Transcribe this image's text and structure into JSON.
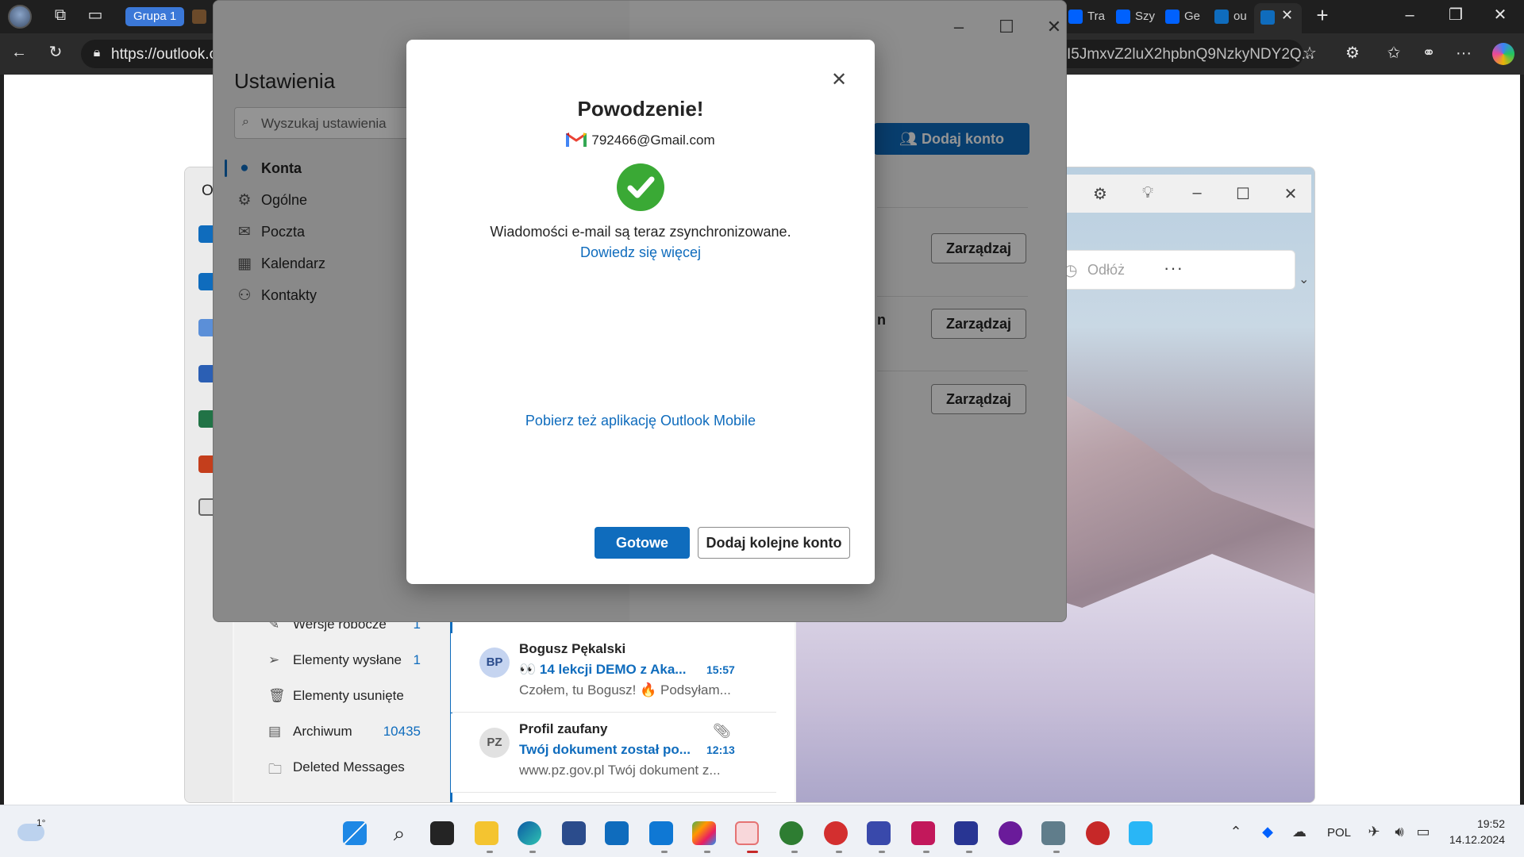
{
  "browser": {
    "tab_group_label": "Grupa 1",
    "tabs": [
      {
        "label": "Tra"
      },
      {
        "label": "Szy"
      },
      {
        "label": "Ge"
      },
      {
        "label": "ou"
      }
    ],
    "url_prefix": "https://outlook.c",
    "url_suffix": "I5JmxvZ2luX2hpbnQ9NzkyNDY2Q..."
  },
  "settings": {
    "title": "Ustawienia",
    "search_placeholder": "Wyszukaj ustawienia",
    "nav_items": [
      {
        "label": "Konta",
        "icon": "person-icon",
        "selected": true
      },
      {
        "label": "Ogólne",
        "icon": "gear-icon"
      },
      {
        "label": "Poczta",
        "icon": "mail-icon"
      },
      {
        "label": "Kalendarz",
        "icon": "calendar-icon"
      },
      {
        "label": "Kontakty",
        "icon": "people-icon"
      }
    ],
    "add_account_label": "Dodaj konto",
    "manage_label": "Zarządzaj",
    "partial_text": "n"
  },
  "dialog": {
    "title": "Powodzenie!",
    "account_email": "792466@Gmail.com",
    "message": "Wiadomości e-mail są teraz zsynchronizowane.",
    "learn_more": "Dowiedz się więcej",
    "mobile_link": "Pobierz też aplikację Outlook Mobile",
    "done_label": "Gotowe",
    "add_another_label": "Dodaj kolejne konto"
  },
  "outlook": {
    "window_letter": "O",
    "snooze_label": "Odłóż",
    "more_label": "···",
    "folders": [
      {
        "label": "Wersje robocze",
        "count": "1"
      },
      {
        "label": "Elementy wysłane",
        "count": "1"
      },
      {
        "label": "Elementy usunięte",
        "count": ""
      },
      {
        "label": "Archiwum",
        "count": "10435"
      },
      {
        "label": "Deleted Messages",
        "count": ""
      }
    ],
    "messages": [
      {
        "initials": "BP",
        "sender": "Bogusz Pękalski",
        "subject": "👀 14 lekcji DEMO z Aka...",
        "time": "15:57",
        "preview": "Czołem, tu Bogusz! 🔥 Podsyłam..."
      },
      {
        "initials": "PZ",
        "sender": "Profil zaufany",
        "subject": "Twój dokument został po...",
        "time": "12:13",
        "preview": "www.pz.gov.pl Twój dokument z..."
      }
    ]
  },
  "taskbar": {
    "weather": "1°",
    "language": "POL",
    "time": "19:52",
    "date": "14.12.2024"
  },
  "colors": {
    "accent": "#0f6cbd",
    "success": "#3aa935"
  }
}
